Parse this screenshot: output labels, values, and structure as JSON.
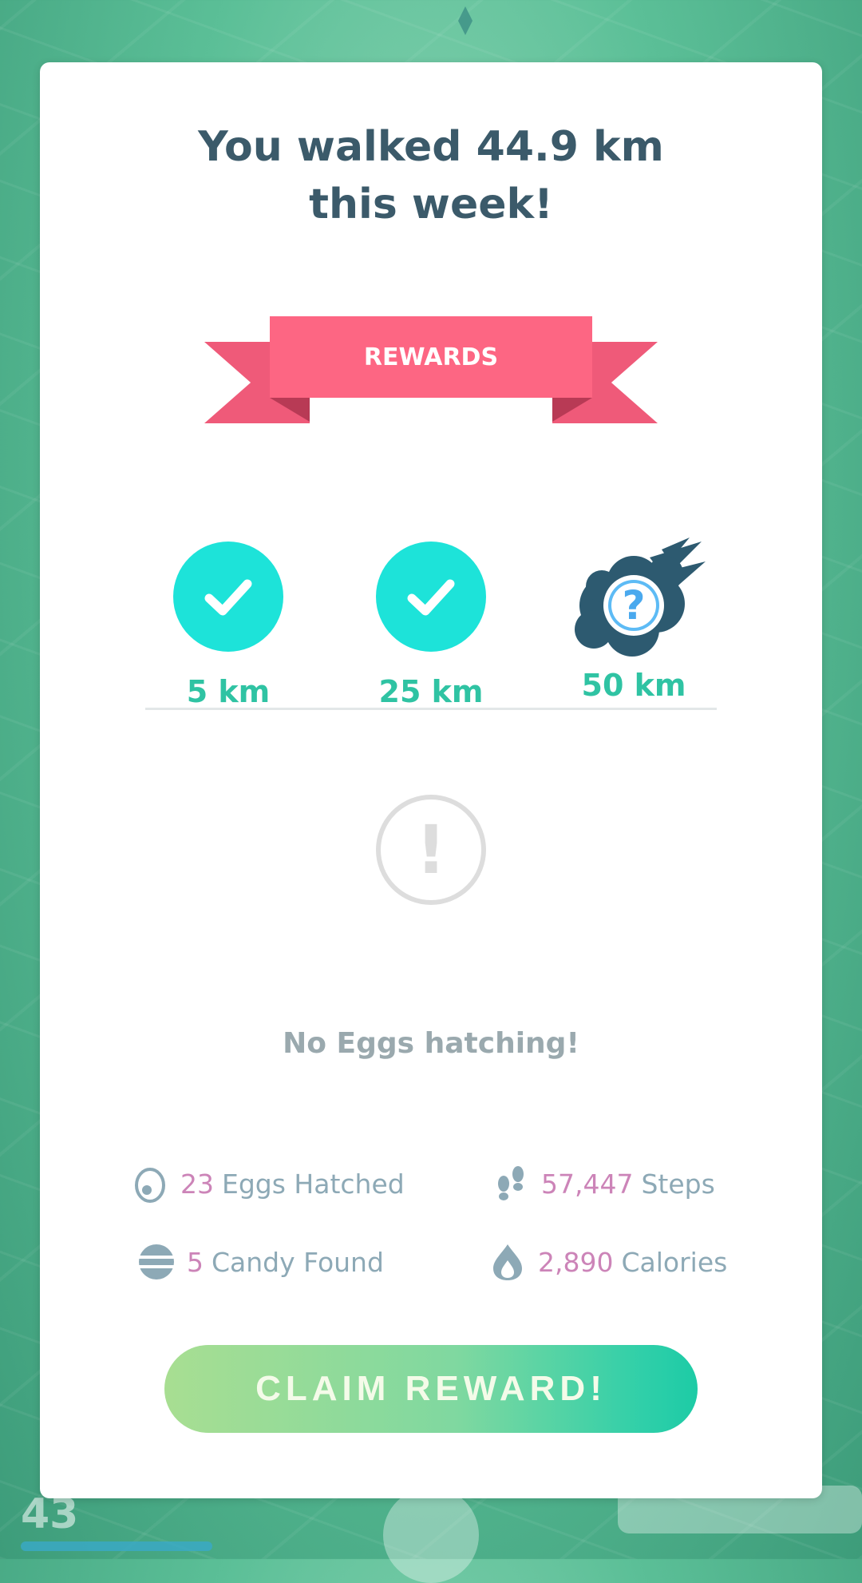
{
  "summary": {
    "title_line1": "You walked 44.9 km",
    "title_line2": "this week!",
    "rewards_label": "REWARDS",
    "milestones": [
      {
        "label": "5 km",
        "state": "completed"
      },
      {
        "label": "25 km",
        "state": "completed"
      },
      {
        "label": "50 km",
        "state": "locked-mystery"
      }
    ],
    "mystery_symbol": "?",
    "alert_symbol": "!",
    "empty_message": "No Eggs hatching!",
    "stats": [
      {
        "icon": "egg-icon",
        "value": "23",
        "label": "Eggs Hatched"
      },
      {
        "icon": "footprints-icon",
        "value": "57,447",
        "label": "Steps"
      },
      {
        "icon": "candy-icon",
        "value": "5",
        "label": "Candy Found"
      },
      {
        "icon": "flame-icon",
        "value": "2,890",
        "label": "Calories"
      }
    ],
    "claim_button": "CLAIM REWARD!"
  },
  "background": {
    "level": "43"
  },
  "colors": {
    "title": "#3b5a6a",
    "ribbon": "#fd6683",
    "check_circle": "#1de3d9",
    "milestone_text": "#2fc3a3",
    "stat_value": "#cc84b8",
    "stat_label": "#8da9b6",
    "claim_gradient_start": "#a8de92",
    "claim_gradient_end": "#1dcba6"
  }
}
